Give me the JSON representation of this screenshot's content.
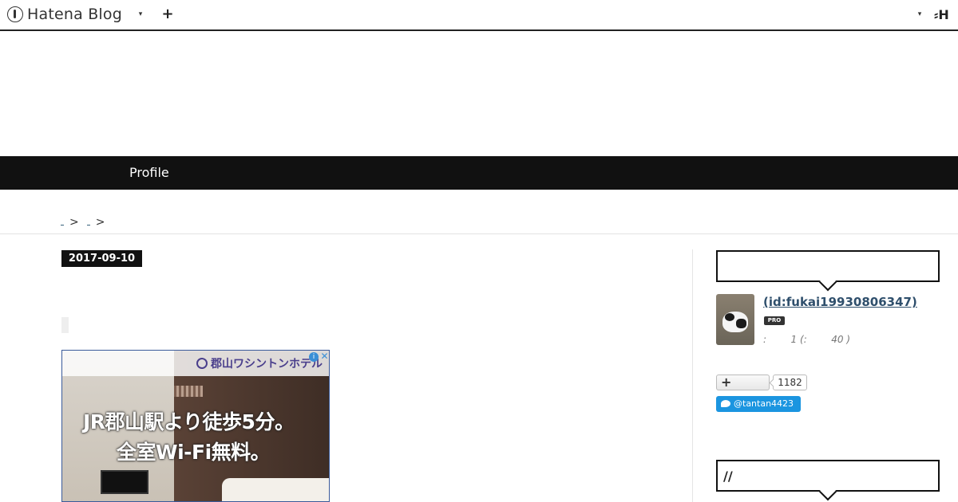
{
  "topbar": {
    "brand": "Hatena Blog",
    "brand_menu_caret": "▾",
    "add_label": "+",
    "user_menu_caret": "▾",
    "right_logo": "H"
  },
  "nav": {
    "items": [
      {
        "label": "Profile"
      }
    ]
  },
  "breadcrumb": {
    "separators": [
      ">",
      ">"
    ]
  },
  "entry": {
    "date": "2017-09-10"
  },
  "ad": {
    "hotel_name": "郡山ワシントンホテル",
    "copy_line1": "JR郡山駅より徒歩5分。",
    "copy_line2": "全室Wi-Fi無料。",
    "info_icon": "i",
    "close_icon": "✕"
  },
  "sidebar": {
    "profile": {
      "id_text": " (id:fukai19930806347)",
      "pro_badge": "PRO",
      "stats": ":        1 (:        40 )"
    },
    "follow": {
      "button_label": "+",
      "count": "1182"
    },
    "twitter": {
      "handle": "@tantan4423"
    },
    "second_module_title": "//"
  }
}
